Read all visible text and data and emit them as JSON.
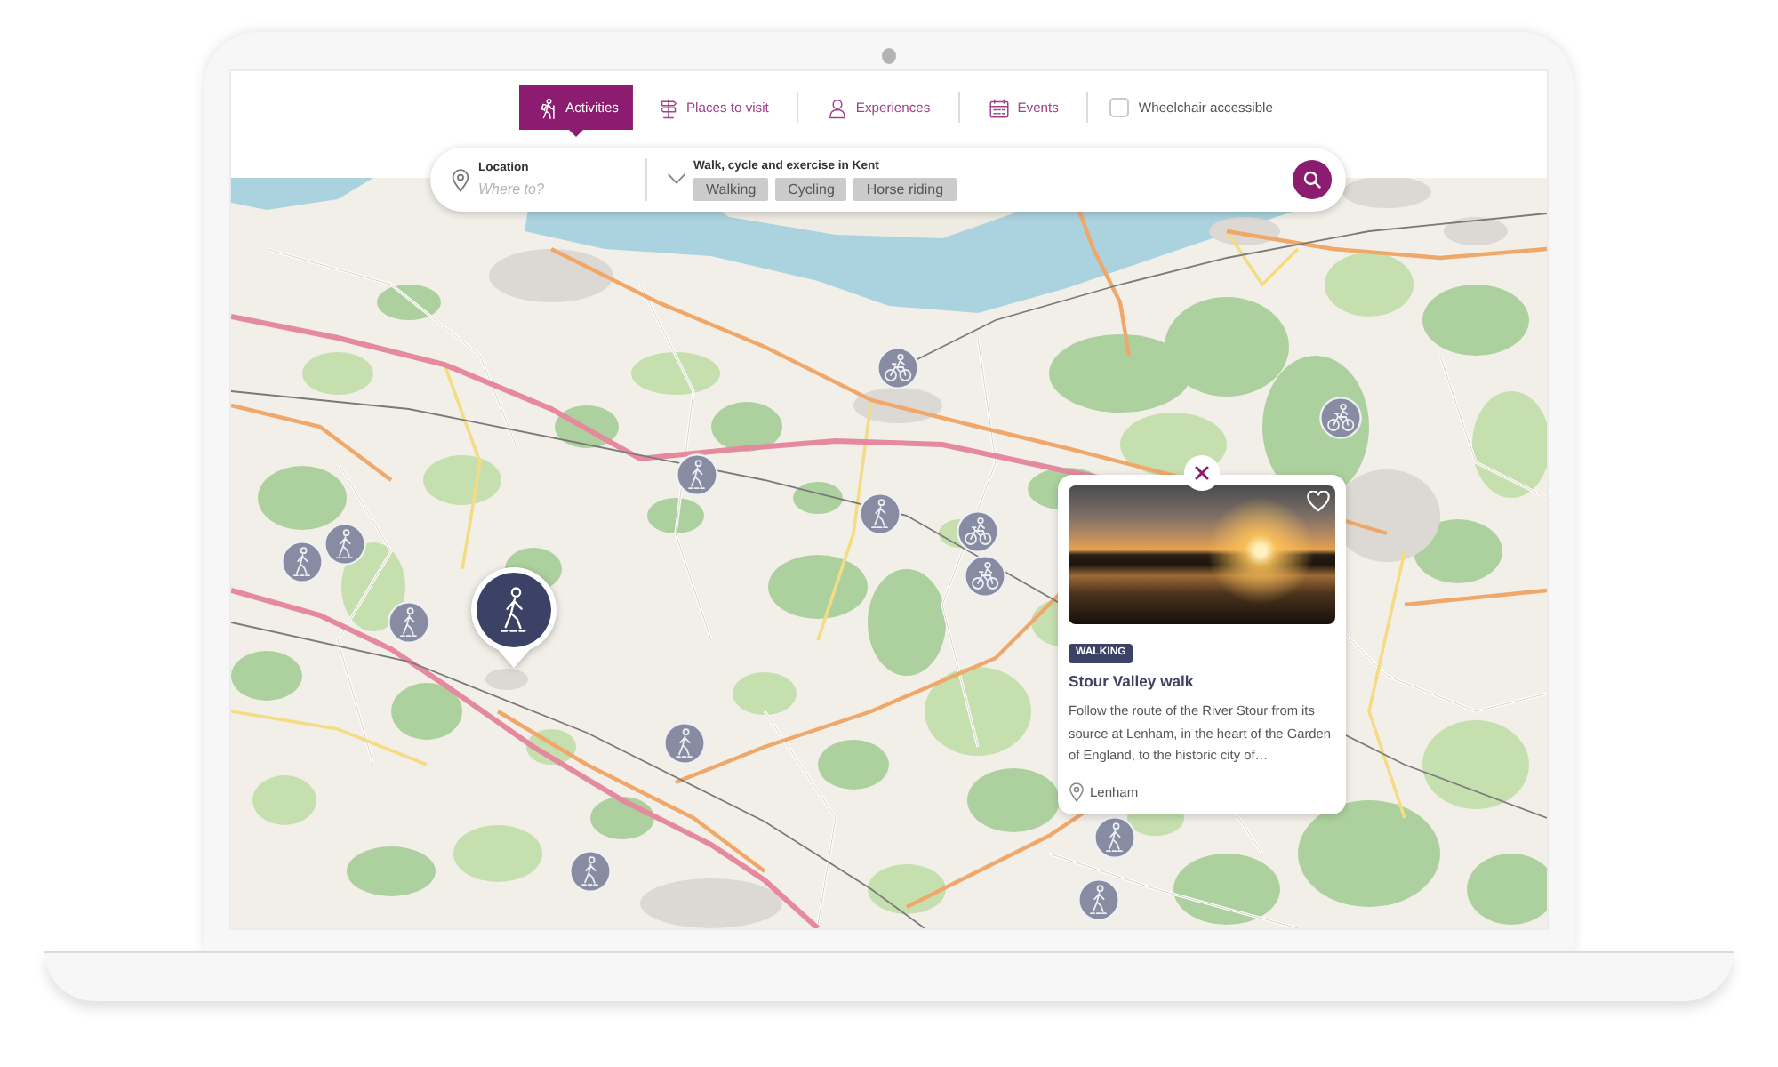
{
  "tabs": [
    {
      "label": "Activities",
      "selected": true
    },
    {
      "label": "Places to visit",
      "selected": false
    },
    {
      "label": "Experiences",
      "selected": false
    },
    {
      "label": "Events",
      "selected": false
    }
  ],
  "wheelchair_filter": {
    "label": "Wheelchair accessible",
    "checked": false
  },
  "search": {
    "location": {
      "label": "Location",
      "placeholder": "Where to?"
    },
    "category": {
      "label": "Walk, cycle and exercise in Kent",
      "chips": [
        "Walking",
        "Cycling",
        "Horse riding"
      ]
    }
  },
  "map": {
    "markers": [
      {
        "kind": "cycling",
        "selected": false
      },
      {
        "kind": "walking",
        "selected": false
      },
      {
        "kind": "walking",
        "selected": false
      },
      {
        "kind": "cycling",
        "selected": false
      },
      {
        "kind": "cycling",
        "selected": false
      },
      {
        "kind": "cycling",
        "selected": false
      },
      {
        "kind": "walking",
        "selected": false
      },
      {
        "kind": "walking",
        "selected": false
      },
      {
        "kind": "walking",
        "selected": false
      },
      {
        "kind": "walking",
        "selected": true
      },
      {
        "kind": "walking",
        "selected": false
      },
      {
        "kind": "walking",
        "selected": false
      },
      {
        "kind": "walking",
        "selected": false
      },
      {
        "kind": "walking",
        "selected": false
      }
    ]
  },
  "popup": {
    "tag": "WALKING",
    "title": "Stour Valley walk",
    "description": "Follow the route of the River Stour from its source at Lenham, in the heart of the Garden of England, to the historic city of…",
    "location": "Lenham",
    "favourite": false
  }
}
